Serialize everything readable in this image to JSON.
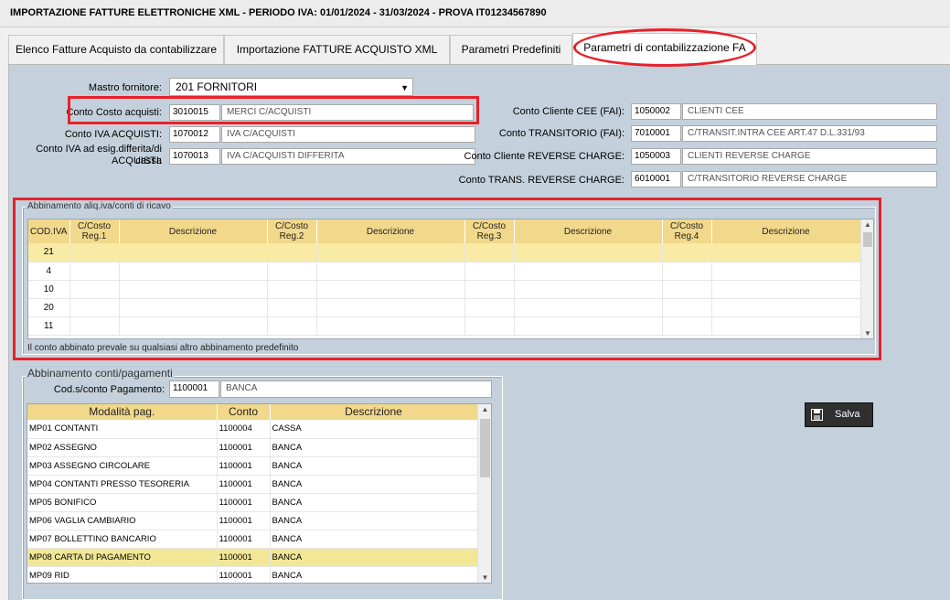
{
  "window": {
    "title": "IMPORTAZIONE FATTURE ELETTRONICHE XML - PERIODO IVA: 01/01/2024 - 31/03/2024 - PROVA IT01234567890"
  },
  "tabs": [
    {
      "label": "Elenco Fatture Acquisto da contabilizzare"
    },
    {
      "label": "Importazione FATTURE ACQUISTO XML"
    },
    {
      "label": "Parametri Predefiniti"
    },
    {
      "label": "Parametri di contabilizzazione FA"
    }
  ],
  "form": {
    "mastro_label": "Mastro fornitore:",
    "mastro_value": "201 FORNITORI",
    "costo_label": "Conto Costo acquisti:",
    "costo_code": "3010015",
    "costo_desc": "MERCI C/ACQUISTI",
    "iva_label": "Conto IVA  ACQUISTI:",
    "iva_code": "1070012",
    "iva_desc": "IVA C/ACQUISTI",
    "ivadiff_label_1": "Conto IVA ad esig.differita/di cassa",
    "ivadiff_label_2": "ACQUISTI:",
    "ivadiff_code": "1070013",
    "ivadiff_desc": "IVA C/ACQUISTI DIFFERITA",
    "cee_label": "Conto Cliente CEE (FAI):",
    "cee_code": "1050002",
    "cee_desc": "CLIENTI CEE",
    "trans_label": "Conto TRANSITORIO (FAI):",
    "trans_code": "7010001",
    "trans_desc": "C/TRANSIT.INTRA CEE ART.47 D.L.331/93",
    "rc_label": "Conto Cliente REVERSE CHARGE:",
    "rc_code": "1050003",
    "rc_desc": "CLIENTI REVERSE CHARGE",
    "trc_label": "Conto TRANS. REVERSE CHARGE:",
    "trc_code": "6010001",
    "trc_desc": "C/TRANSITORIO REVERSE CHARGE"
  },
  "aliq_group": {
    "title": "Abbinamento aliq.iva/conti di ricavo",
    "columns": [
      "COD.IVA",
      "C/Costo Reg.1",
      "Descrizione",
      "C/Costo Reg.2",
      "Descrizione",
      "C/Costo Reg.3",
      "Descrizione",
      "C/Costo Reg.4",
      "Descrizione"
    ],
    "rows": [
      "21",
      "4",
      "10",
      "20",
      "11"
    ],
    "note": "Il conto abbinato prevale su qualsiasi altro abbinamento predefinito"
  },
  "pay_group": {
    "title": "Abbinamento conti/pagamenti",
    "cod_label": "Cod.s/conto Pagamento:",
    "cod_value": "1100001",
    "cod_desc": "BANCA",
    "columns": [
      "Modalità pag.",
      "Conto",
      "Descrizione"
    ],
    "rows": [
      [
        "MP01 CONTANTI",
        "1100004",
        "CASSA"
      ],
      [
        "MP02 ASSEGNO",
        "1100001",
        "BANCA"
      ],
      [
        "MP03 ASSEGNO CIRCOLARE",
        "1100001",
        "BANCA"
      ],
      [
        "MP04 CONTANTI PRESSO TESORERIA",
        "1100001",
        "BANCA"
      ],
      [
        "MP05 BONIFICO",
        "1100001",
        "BANCA"
      ],
      [
        "MP06 VAGLIA CAMBIARIO",
        "1100001",
        "BANCA"
      ],
      [
        "MP07 BOLLETTINO BANCARIO",
        "1100001",
        "BANCA"
      ],
      [
        "MP08 CARTA DI PAGAMENTO",
        "1100001",
        "BANCA"
      ],
      [
        "MP09 RID",
        "1100001",
        "BANCA"
      ]
    ]
  },
  "save_button": {
    "label": "Salva",
    "icon": "save-icon"
  },
  "colors": {
    "panel": "#c4d1dd",
    "grid_header": "#f2d88a",
    "selected_row": "#f1e797",
    "highlight": "#e8212a"
  }
}
